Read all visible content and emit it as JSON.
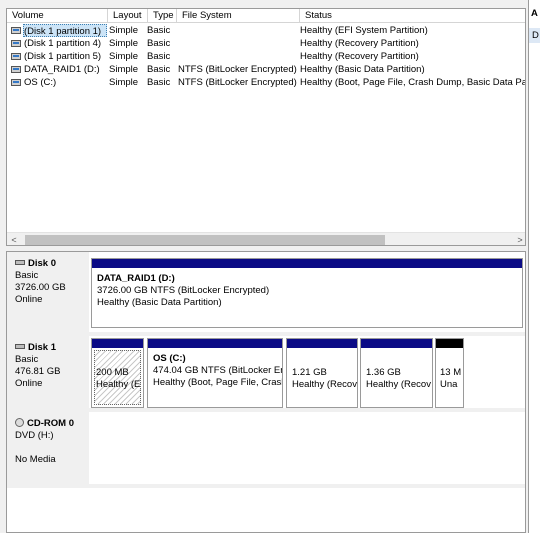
{
  "columns": [
    "Volume",
    "Layout",
    "Type",
    "File System",
    "Status"
  ],
  "volumes": [
    {
      "volume": "(Disk 1 partition 1)",
      "layout": "Simple",
      "type": "Basic",
      "fs": "",
      "status": "Healthy (EFI System Partition)"
    },
    {
      "volume": "(Disk 1 partition 4)",
      "layout": "Simple",
      "type": "Basic",
      "fs": "",
      "status": "Healthy (Recovery Partition)"
    },
    {
      "volume": "(Disk 1 partition 5)",
      "layout": "Simple",
      "type": "Basic",
      "fs": "",
      "status": "Healthy (Recovery Partition)"
    },
    {
      "volume": "DATA_RAID1 (D:)",
      "layout": "Simple",
      "type": "Basic",
      "fs": "NTFS (BitLocker Encrypted)",
      "status": "Healthy (Basic Data Partition)"
    },
    {
      "volume": "OS (C:)",
      "layout": "Simple",
      "type": "Basic",
      "fs": "NTFS (BitLocker Encrypted)",
      "status": "Healthy (Boot, Page File, Crash Dump, Basic Data Partit"
    }
  ],
  "scroll": {
    "left_arrow": "<",
    "right_arrow": ">"
  },
  "actions": {
    "header": "A",
    "item": "D"
  },
  "disks": [
    {
      "name": "Disk 0",
      "type": "Basic",
      "size": "3726.00 GB",
      "status": "Online",
      "partitions": [
        {
          "title": "DATA_RAID1  (D:)",
          "line1": "3726.00 GB NTFS (BitLocker Encrypted)",
          "line2": "Healthy (Basic Data Partition)"
        }
      ]
    },
    {
      "name": "Disk 1",
      "type": "Basic",
      "size": "476.81 GB",
      "status": "Online",
      "partitions": [
        {
          "title": "",
          "line1": "200 MB",
          "line2": "Healthy (E"
        },
        {
          "title": "OS  (C:)",
          "line1": "474.04 GB NTFS (BitLocker Encr",
          "line2": "Healthy (Boot, Page File, Crasl"
        },
        {
          "title": "",
          "line1": "1.21 GB",
          "line2": "Healthy (Recov"
        },
        {
          "title": "",
          "line1": "1.36 GB",
          "line2": "Healthy (Recov"
        },
        {
          "title": "",
          "line1": "13 M",
          "line2": "Una"
        }
      ]
    },
    {
      "name": "CD-ROM 0",
      "type": "DVD (H:)",
      "size": "",
      "status": "No Media"
    }
  ]
}
